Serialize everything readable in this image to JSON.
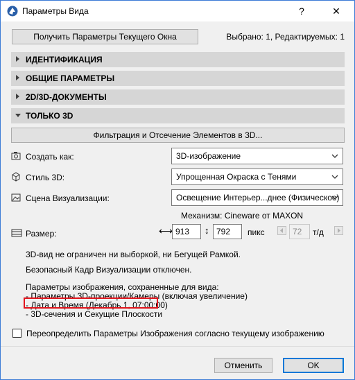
{
  "window": {
    "title": "Параметры Вида",
    "help": "?",
    "close": "✕"
  },
  "top": {
    "get_button": "Получить Параметры Текущего Окна",
    "status": "Выбрано: 1, Редактируемых: 1"
  },
  "sections": [
    {
      "label": "ИДЕНТИФИКАЦИЯ",
      "expanded": false
    },
    {
      "label": "ОБЩИЕ ПАРАМЕТРЫ",
      "expanded": false
    },
    {
      "label": "2D/3D-ДОКУМЕНТЫ",
      "expanded": false
    },
    {
      "label": "ТОЛЬКО 3D",
      "expanded": true
    }
  ],
  "only3d": {
    "filter_button": "Фильтрация и Отсечение Элементов в 3D...",
    "create_as": {
      "label": "Создать как:",
      "value": "3D-изображение",
      "icon": "camera-icon"
    },
    "style3d": {
      "label": "Стиль 3D:",
      "value": "Упрощенная Окраска с Тенями",
      "icon": "cube-icon"
    },
    "scene": {
      "label": "Сцена Визуализации:",
      "value": "Освещение Интерьер...днее (Физическое)",
      "icon": "image-icon"
    },
    "engine": "Механизм: Cineware от MAXON",
    "size": {
      "label": "Размер:",
      "width": "913",
      "height": "792",
      "unit": "пикс",
      "dpi": "72",
      "dpi_unit": "т/д"
    },
    "info1": "3D-вид не ограничен ни выборкой, ни Бегущей Рамкой.",
    "info2": "Безопасный Кадр Визуализации отключен.",
    "saved_header": "Параметры изображения, сохраненные для вида:",
    "saved_items": [
      "- Параметры 3D-проекции/Камеры (включая увеличение)",
      "- Дата и Время (Декабрь 1, 07:00:00)",
      "- 3D-сечения и Секущие Плоскости"
    ],
    "override_label": "Переопределить Параметры Изображения согласно текущему изображению",
    "override_checked": false
  },
  "footer": {
    "cancel": "Отменить",
    "ok": "OK"
  },
  "colors": {
    "accent": "#0078d7",
    "highlight": "#e2141c",
    "section_bg": "#d6d6d6"
  }
}
